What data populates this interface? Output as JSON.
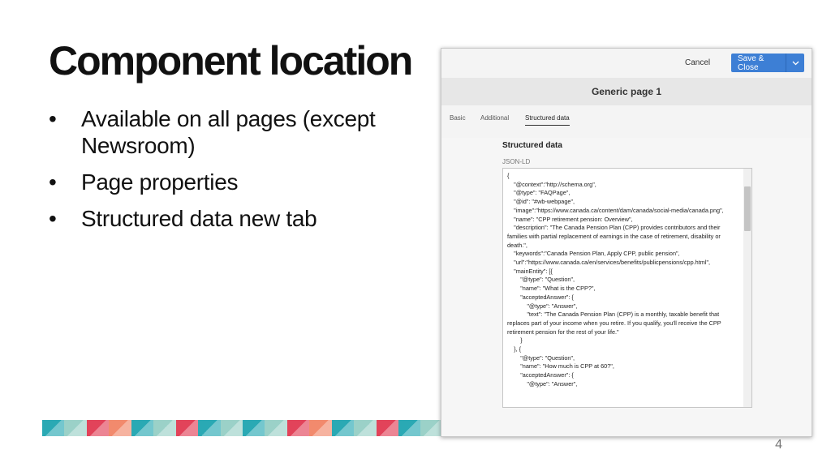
{
  "slide": {
    "title": "Component location",
    "bullets": [
      "Available on all pages (except Newsroom)",
      "Page properties",
      "Structured data new tab"
    ],
    "bullet_glyph": "•",
    "page_number": "4",
    "stripe_colors": [
      "#2aa9b4",
      "#9bd1c8",
      "#e2435a",
      "#f28a6d",
      "#2aa9b4",
      "#9bd1c8",
      "#e2435a",
      "#2aa9b4",
      "#9bd1c8",
      "#2aa9b4",
      "#9bd1c8",
      "#e2435a",
      "#f28a6d",
      "#2aa9b4",
      "#9bd1c8",
      "#e2435a",
      "#2aa9b4",
      "#9bd1c8"
    ]
  },
  "dialog": {
    "cancel_label": "Cancel",
    "save_label": "Save & Close",
    "caret_icon": "chevron-down-icon",
    "page_title": "Generic page 1",
    "tabs": [
      {
        "label": "Basic",
        "active": false
      },
      {
        "label": "Additional",
        "active": false
      },
      {
        "label": "Structured data",
        "active": true
      }
    ],
    "section_title": "Structured data",
    "field_label": "JSON-LD",
    "code": "{\n    \"@context\":\"http://schema.org\",\n    \"@type\": \"FAQPage\",\n    \"@id\": \"#wb-webpage\",\n    \"image\":\"https://www.canada.ca/content/dam/canada/social-media/canada.png\",\n    \"name\": \"CPP retirement pension: Overview\",\n    \"description\": \"The Canada Pension Plan (CPP) provides contributors and their families with partial replacement of earnings in the case of retirement, disability or death.\",\n    \"keywords\":\"Canada Pension Plan, Apply CPP, public pension\",\n    \"url\":\"https://www.canada.ca/en/services/benefits/publicpensions/cpp.html\",\n    \"mainEntity\": [{\n        \"@type\": \"Question\",\n        \"name\": \"What is the CPP?\",\n        \"acceptedAnswer\": {\n            \"@type\": \"Answer\",\n            \"text\": \"The Canada Pension Plan (CPP) is a monthly, taxable benefit that replaces part of your income when you retire. If you qualify, you'll receive the CPP retirement pension for the rest of your life.\"\n        }\n    }, {\n        \"@type\": \"Question\",\n        \"name\": \"How much is CPP at 60?\",\n        \"acceptedAnswer\": {\n            \"@type\": \"Answer\","
  }
}
